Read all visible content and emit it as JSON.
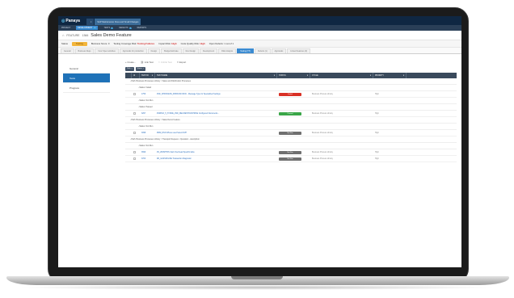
{
  "app": {
    "brand": "Panaya",
    "brand_icon": "panaya-logo-icon",
    "tabs": [
      {
        "label": "",
        "active": false
      },
      {
        "label": "SAP Maintenance Fixes and Small Changes",
        "active": true
      }
    ]
  },
  "nav": {
    "items": [
      {
        "label": "PROJECT",
        "active": false,
        "badge": ""
      },
      {
        "label": "DEVELOPMENT",
        "active": true,
        "badge": "12"
      },
      {
        "label": "TESTS",
        "active": false,
        "badge": "1"
      },
      {
        "label": "DEFECTS",
        "active": false,
        "badge": "3"
      },
      {
        "label": "REPORTS",
        "active": false,
        "badge": ""
      }
    ]
  },
  "title": {
    "type_label": "FEATURE",
    "id": "1366",
    "name": "Sales Demo Feature",
    "home_icon": "home-icon"
  },
  "status": {
    "label": "Status",
    "value": "Testing",
    "business_score_label": "Business Score:",
    "business_score": "0",
    "coverage_label": "Testing Coverage Risk:",
    "coverage": "Testing Failures",
    "impact_label": "Impact Risk:",
    "impact": "High",
    "code_quality_label": "Code Quality Risk:",
    "code_quality": "High",
    "open_defects_label": "Open Defects:",
    "open_defects": "1 out of 1"
  },
  "subtabs": [
    {
      "label": "General",
      "active": false
    },
    {
      "label": "Business Reqs",
      "active": false
    },
    {
      "label": "Func Spec activities",
      "active": false
    },
    {
      "label": "Approvals for production",
      "active": false
    },
    {
      "label": "Design",
      "active": false
    },
    {
      "label": "Budget Estimate",
      "active": false
    },
    {
      "label": "Dev Design",
      "active": false
    },
    {
      "label": "Development",
      "active": false
    },
    {
      "label": "Risk Analysis",
      "active": false
    },
    {
      "label": "Testing (TT)",
      "active": true
    },
    {
      "label": "Defects (1)",
      "active": false
    },
    {
      "label": "Approvals",
      "active": false
    },
    {
      "label": "Linked Features (0)",
      "active": false
    }
  ],
  "sidebar": {
    "items": [
      {
        "label": "General",
        "active": false
      },
      {
        "label": "Tests",
        "active": true
      },
      {
        "label": "Progress",
        "active": false
      }
    ]
  },
  "toolbar": {
    "create": "+ Create...",
    "link_test": "Link Test",
    "unlink_test": "Unlink Test",
    "export": "Export"
  },
  "filters": [
    "Path",
    "Status"
  ],
  "table": {
    "columns": [
      "",
      "",
      "TEST ID",
      "TEST NAME",
      "STATUS",
      "CYCLE",
      "PRIORITY"
    ],
    "groups": [
      {
        "path": "Path: Business Processes Library > Sales and Distribution Processes",
        "subgroups": [
          {
            "status": "Status: Failed",
            "rows": [
              {
                "id": "1756",
                "name": "ZSD_CPROCESS_INBOUND IDOC - Message Type for Specialized Settings",
                "status": "Failed",
                "cycle": "Business Process Library",
                "priority": "High"
              }
            ]
          },
          {
            "status": "Status: Not Run",
            "rows": []
          },
          {
            "status": "Status: Passed",
            "rows": [
              {
                "id": "3297",
                "name": "ZSDPLD_5_SYNNE_ZSD_REL/RESTRUCPRICE Configured Documents...",
                "status": "Passed",
                "cycle": "Business Process Library",
                "priority": "High"
              }
            ]
          }
        ]
      },
      {
        "path": "Path: Business Processes Library > Sales Demo Feature",
        "subgroups": [
          {
            "status": "Status: Not Run",
            "rows": [
              {
                "id": "3098",
                "name": "ZMM_NNO Where used Select DVP",
                "status": "Not Run",
                "cycle": "Business Process Library",
                "priority": "High"
              }
            ]
          }
        ]
      },
      {
        "path": "Path: Business Processes Library > Transport Request - Operation - description",
        "subgroups": [
          {
            "status": "Status: Not Run",
            "rows": [
              {
                "id": "3699",
                "name": "ZS_ZDISPTRS Clerk Overhead Specific table",
                "status": "Not Run",
                "cycle": "Business Process Library",
                "priority": "High"
              },
              {
                "id": "3703",
                "name": "ZR_GASSOFLIKE Transaction Diagnostic",
                "status": "Not Run",
                "cycle": "Business Process Library",
                "priority": "High"
              }
            ]
          }
        ]
      }
    ]
  },
  "colors": {
    "topbar": "#0f2742",
    "accent": "#3b8bd1",
    "failed": "#d93025",
    "passed": "#3aa648",
    "not_run": "#6f6f6f",
    "status_pill": "#f3b53a"
  }
}
